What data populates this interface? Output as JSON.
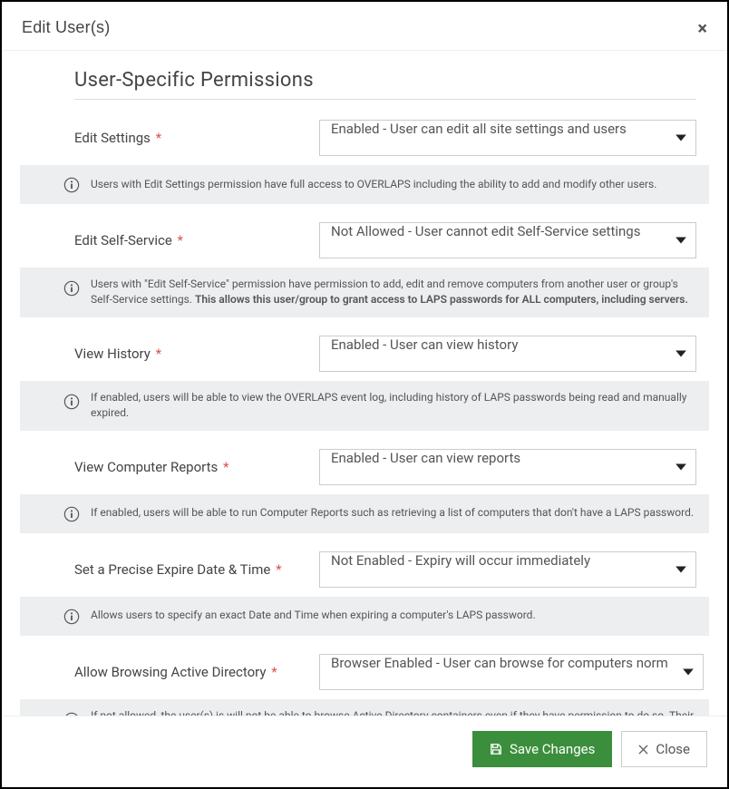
{
  "modal": {
    "title": "Edit User(s)"
  },
  "section": {
    "title": "User-Specific Permissions"
  },
  "fields": {
    "editSettings": {
      "label": "Edit Settings",
      "value": "Enabled - User can edit all site settings and users",
      "info": "Users with Edit Settings permission have full access to OVERLAPS including the ability to add and modify other users."
    },
    "editSelfService": {
      "label": "Edit Self-Service",
      "value": "Not Allowed - User cannot edit Self-Service settings",
      "info_prefix": "Users with \"Edit Self-Service\" permission have permission to add, edit and remove computers from another user or group's Self-Service settings. ",
      "info_bold": "This allows this user/group to grant access to LAPS passwords for ALL computers, including servers."
    },
    "viewHistory": {
      "label": "View History",
      "value": "Enabled - User can view history",
      "info": "If enabled, users will be able to view the OVERLAPS event log, including history of LAPS passwords being read and manually expired."
    },
    "viewReports": {
      "label": "View Computer Reports",
      "value": "Enabled - User can view reports",
      "info": "If enabled, users will be able to run Computer Reports such as retrieving a list of computers that don't have a LAPS password."
    },
    "preciseExpire": {
      "label": "Set a Precise Expire Date & Time",
      "value": "Not Enabled - Expiry will occur immediately",
      "info": "Allows users to specify an exact Date and Time when expiring a computer's LAPS password."
    },
    "allowBrowsing": {
      "label": "Allow Browsing Active Directory",
      "value": "Browser Enabled - User can browse for computers norm",
      "info": "If not allowed, the user(s) is will not be able to browse Active Directory containers even if they have permission to do so. Their only means of accessing a computer that they have permission to is by searching for it."
    }
  },
  "buttons": {
    "save": "Save Changes",
    "close": "Close"
  }
}
